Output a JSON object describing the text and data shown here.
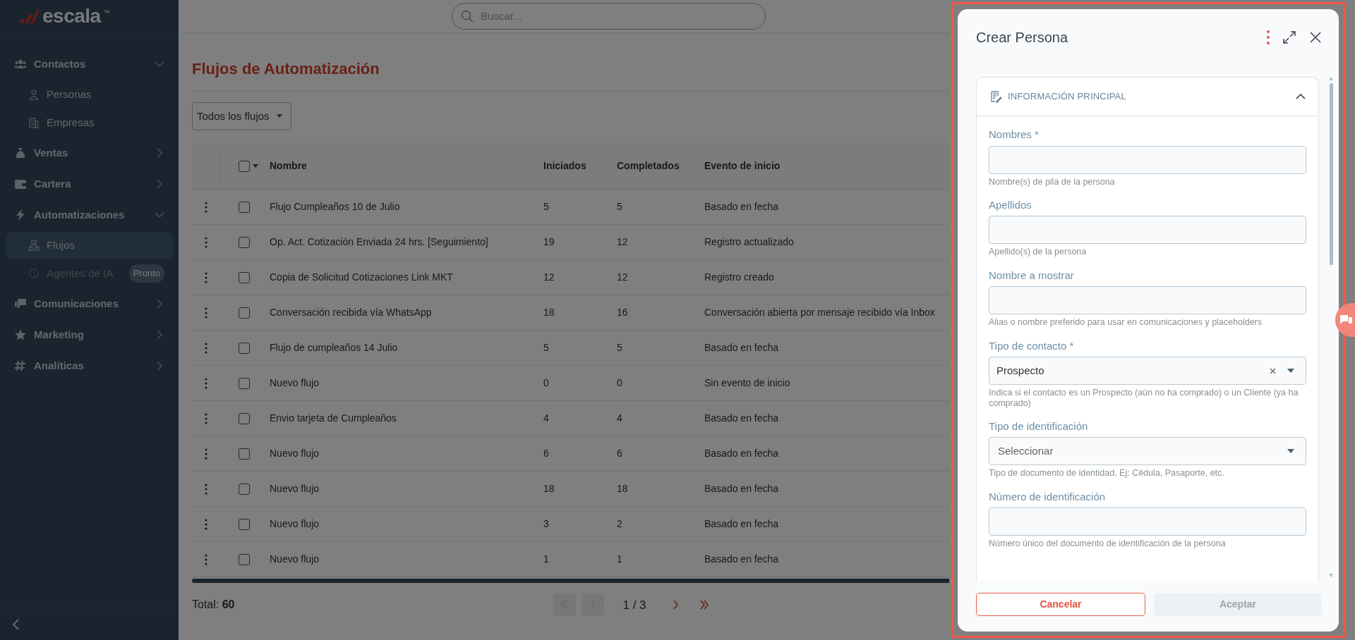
{
  "sidebar": {
    "logo": "escala",
    "logo_mark": "™",
    "items": [
      {
        "label": "Contactos",
        "expanded": true,
        "children": [
          {
            "label": "Personas",
            "selected": false,
            "disabled": false
          },
          {
            "label": "Empresas",
            "selected": false,
            "disabled": false
          }
        ]
      },
      {
        "label": "Ventas",
        "expanded": false
      },
      {
        "label": "Cartera",
        "expanded": false
      },
      {
        "label": "Automatizaciones",
        "expanded": true,
        "children": [
          {
            "label": "Flujos",
            "selected": true,
            "disabled": false
          },
          {
            "label": "Agentes de IA",
            "selected": false,
            "disabled": true,
            "badge": "Pronto"
          }
        ]
      },
      {
        "label": "Comunicaciones",
        "expanded": false
      },
      {
        "label": "Marketing",
        "expanded": false
      },
      {
        "label": "Analíticas",
        "expanded": false
      }
    ]
  },
  "topbar": {
    "search": {
      "placeholder": "Buscar..."
    }
  },
  "page": {
    "title": "Flujos de Automatización",
    "filter": "Todos los flujos"
  },
  "table": {
    "header_checked": false,
    "columns": [
      "Nombre",
      "Iniciados",
      "Completados",
      "Evento de inicio"
    ],
    "rows": [
      {
        "checked": false,
        "cells": [
          "Flujo Cumpleaños 10 de Julio",
          "5",
          "5",
          "Basado en fecha"
        ]
      },
      {
        "checked": false,
        "cells": [
          "Op. Act. Cotización Enviada 24 hrs. [Seguimiento]",
          "19",
          "12",
          "Registro actualizado"
        ]
      },
      {
        "checked": false,
        "cells": [
          "Copia de Solicitud Cotizaciones Link MKT",
          "12",
          "12",
          "Registro creado"
        ]
      },
      {
        "checked": false,
        "cells": [
          "Conversación recibida vía WhatsApp",
          "18",
          "16",
          "Conversación abierta por mensaje recibido vía Inbox"
        ]
      },
      {
        "checked": false,
        "cells": [
          "Flujo de cumpleaños 14 Julio",
          "5",
          "5",
          "Basado en fecha"
        ]
      },
      {
        "checked": false,
        "cells": [
          "Nuevo flujo",
          "0",
          "0",
          "Sin evento de inicio"
        ]
      },
      {
        "checked": false,
        "cells": [
          "Envio tarjeta de Cumpleaños",
          "4",
          "4",
          "Basado en fecha"
        ]
      },
      {
        "checked": false,
        "cells": [
          "Nuevo flujo",
          "6",
          "6",
          "Basado en fecha"
        ]
      },
      {
        "checked": false,
        "cells": [
          "Nuevo flujo",
          "18",
          "18",
          "Basado en fecha"
        ]
      },
      {
        "checked": false,
        "cells": [
          "Nuevo flujo",
          "3",
          "2",
          "Basado en fecha"
        ]
      },
      {
        "checked": false,
        "cells": [
          "Nuevo flujo",
          "1",
          "1",
          "Basado en fecha"
        ]
      }
    ]
  },
  "footer": {
    "total_label": "Total:",
    "total": "60",
    "page": "1 / 3",
    "pager": [
      {
        "kind": "first",
        "disabled": true
      },
      {
        "kind": "prev",
        "disabled": true
      },
      {
        "kind": "next",
        "disabled": false
      },
      {
        "kind": "last",
        "disabled": false
      }
    ]
  },
  "dialog": {
    "title": "Crear Persona",
    "section": {
      "title": "INFORMACIÓN PRINCIPAL",
      "expanded": true,
      "fields": [
        {
          "kind": "text",
          "label": "Nombres *",
          "help": "Nombre(s) de pila de la persona"
        },
        {
          "kind": "text",
          "label": "Apellidos",
          "help": "Apellido(s) de la persona"
        },
        {
          "kind": "text",
          "label": "Nombre a mostrar",
          "help": "Alias o nombre preferido para usar en comunicaciones y placeholders"
        },
        {
          "kind": "select",
          "label": "Tipo de contacto *",
          "value": "Prospecto",
          "clearable": true,
          "help": "Indica si el contacto es un Prospecto (aún no ha comprado) o un Cliente (ya ha comprado)"
        },
        {
          "kind": "select",
          "label": "Tipo de identificación",
          "placeholder": "Seleccionar",
          "clearable": false,
          "help": "Tipo de documento de identidad. Ej: Cédula, Pasaporte, etc."
        },
        {
          "kind": "text",
          "label": "Número de identificación",
          "help": "Número único del documento de identificación de la persona"
        }
      ]
    },
    "buttons": [
      {
        "label": "Cancelar",
        "kind": "outline",
        "disabled": false
      },
      {
        "label": "Aceptar",
        "kind": "primary",
        "disabled": true
      }
    ]
  }
}
